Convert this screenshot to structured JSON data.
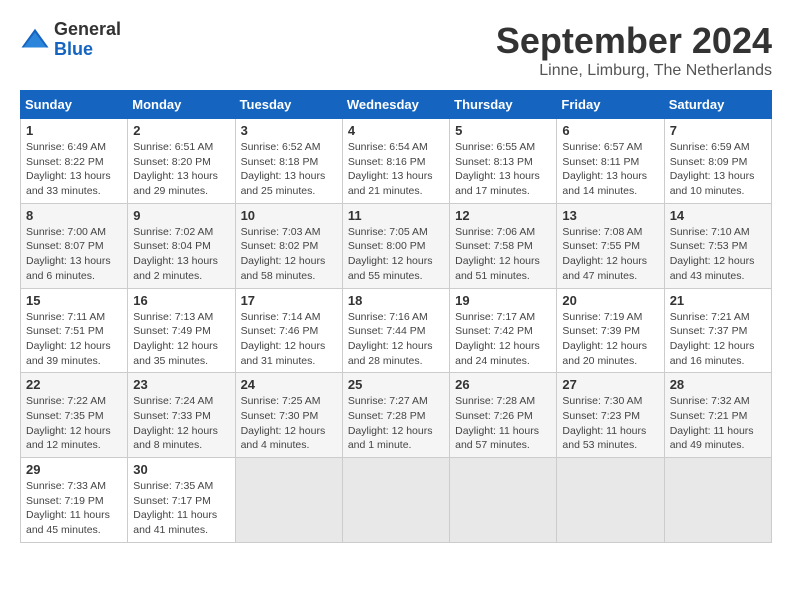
{
  "logo": {
    "general": "General",
    "blue": "Blue"
  },
  "title": "September 2024",
  "location": "Linne, Limburg, The Netherlands",
  "headers": [
    "Sunday",
    "Monday",
    "Tuesday",
    "Wednesday",
    "Thursday",
    "Friday",
    "Saturday"
  ],
  "weeks": [
    [
      {
        "day": "1",
        "sunrise": "Sunrise: 6:49 AM",
        "sunset": "Sunset: 8:22 PM",
        "daylight": "Daylight: 13 hours and 33 minutes."
      },
      {
        "day": "2",
        "sunrise": "Sunrise: 6:51 AM",
        "sunset": "Sunset: 8:20 PM",
        "daylight": "Daylight: 13 hours and 29 minutes."
      },
      {
        "day": "3",
        "sunrise": "Sunrise: 6:52 AM",
        "sunset": "Sunset: 8:18 PM",
        "daylight": "Daylight: 13 hours and 25 minutes."
      },
      {
        "day": "4",
        "sunrise": "Sunrise: 6:54 AM",
        "sunset": "Sunset: 8:16 PM",
        "daylight": "Daylight: 13 hours and 21 minutes."
      },
      {
        "day": "5",
        "sunrise": "Sunrise: 6:55 AM",
        "sunset": "Sunset: 8:13 PM",
        "daylight": "Daylight: 13 hours and 17 minutes."
      },
      {
        "day": "6",
        "sunrise": "Sunrise: 6:57 AM",
        "sunset": "Sunset: 8:11 PM",
        "daylight": "Daylight: 13 hours and 14 minutes."
      },
      {
        "day": "7",
        "sunrise": "Sunrise: 6:59 AM",
        "sunset": "Sunset: 8:09 PM",
        "daylight": "Daylight: 13 hours and 10 minutes."
      }
    ],
    [
      {
        "day": "8",
        "sunrise": "Sunrise: 7:00 AM",
        "sunset": "Sunset: 8:07 PM",
        "daylight": "Daylight: 13 hours and 6 minutes."
      },
      {
        "day": "9",
        "sunrise": "Sunrise: 7:02 AM",
        "sunset": "Sunset: 8:04 PM",
        "daylight": "Daylight: 13 hours and 2 minutes."
      },
      {
        "day": "10",
        "sunrise": "Sunrise: 7:03 AM",
        "sunset": "Sunset: 8:02 PM",
        "daylight": "Daylight: 12 hours and 58 minutes."
      },
      {
        "day": "11",
        "sunrise": "Sunrise: 7:05 AM",
        "sunset": "Sunset: 8:00 PM",
        "daylight": "Daylight: 12 hours and 55 minutes."
      },
      {
        "day": "12",
        "sunrise": "Sunrise: 7:06 AM",
        "sunset": "Sunset: 7:58 PM",
        "daylight": "Daylight: 12 hours and 51 minutes."
      },
      {
        "day": "13",
        "sunrise": "Sunrise: 7:08 AM",
        "sunset": "Sunset: 7:55 PM",
        "daylight": "Daylight: 12 hours and 47 minutes."
      },
      {
        "day": "14",
        "sunrise": "Sunrise: 7:10 AM",
        "sunset": "Sunset: 7:53 PM",
        "daylight": "Daylight: 12 hours and 43 minutes."
      }
    ],
    [
      {
        "day": "15",
        "sunrise": "Sunrise: 7:11 AM",
        "sunset": "Sunset: 7:51 PM",
        "daylight": "Daylight: 12 hours and 39 minutes."
      },
      {
        "day": "16",
        "sunrise": "Sunrise: 7:13 AM",
        "sunset": "Sunset: 7:49 PM",
        "daylight": "Daylight: 12 hours and 35 minutes."
      },
      {
        "day": "17",
        "sunrise": "Sunrise: 7:14 AM",
        "sunset": "Sunset: 7:46 PM",
        "daylight": "Daylight: 12 hours and 31 minutes."
      },
      {
        "day": "18",
        "sunrise": "Sunrise: 7:16 AM",
        "sunset": "Sunset: 7:44 PM",
        "daylight": "Daylight: 12 hours and 28 minutes."
      },
      {
        "day": "19",
        "sunrise": "Sunrise: 7:17 AM",
        "sunset": "Sunset: 7:42 PM",
        "daylight": "Daylight: 12 hours and 24 minutes."
      },
      {
        "day": "20",
        "sunrise": "Sunrise: 7:19 AM",
        "sunset": "Sunset: 7:39 PM",
        "daylight": "Daylight: 12 hours and 20 minutes."
      },
      {
        "day": "21",
        "sunrise": "Sunrise: 7:21 AM",
        "sunset": "Sunset: 7:37 PM",
        "daylight": "Daylight: 12 hours and 16 minutes."
      }
    ],
    [
      {
        "day": "22",
        "sunrise": "Sunrise: 7:22 AM",
        "sunset": "Sunset: 7:35 PM",
        "daylight": "Daylight: 12 hours and 12 minutes."
      },
      {
        "day": "23",
        "sunrise": "Sunrise: 7:24 AM",
        "sunset": "Sunset: 7:33 PM",
        "daylight": "Daylight: 12 hours and 8 minutes."
      },
      {
        "day": "24",
        "sunrise": "Sunrise: 7:25 AM",
        "sunset": "Sunset: 7:30 PM",
        "daylight": "Daylight: 12 hours and 4 minutes."
      },
      {
        "day": "25",
        "sunrise": "Sunrise: 7:27 AM",
        "sunset": "Sunset: 7:28 PM",
        "daylight": "Daylight: 12 hours and 1 minute."
      },
      {
        "day": "26",
        "sunrise": "Sunrise: 7:28 AM",
        "sunset": "Sunset: 7:26 PM",
        "daylight": "Daylight: 11 hours and 57 minutes."
      },
      {
        "day": "27",
        "sunrise": "Sunrise: 7:30 AM",
        "sunset": "Sunset: 7:23 PM",
        "daylight": "Daylight: 11 hours and 53 minutes."
      },
      {
        "day": "28",
        "sunrise": "Sunrise: 7:32 AM",
        "sunset": "Sunset: 7:21 PM",
        "daylight": "Daylight: 11 hours and 49 minutes."
      }
    ],
    [
      {
        "day": "29",
        "sunrise": "Sunrise: 7:33 AM",
        "sunset": "Sunset: 7:19 PM",
        "daylight": "Daylight: 11 hours and 45 minutes."
      },
      {
        "day": "30",
        "sunrise": "Sunrise: 7:35 AM",
        "sunset": "Sunset: 7:17 PM",
        "daylight": "Daylight: 11 hours and 41 minutes."
      },
      null,
      null,
      null,
      null,
      null
    ]
  ]
}
